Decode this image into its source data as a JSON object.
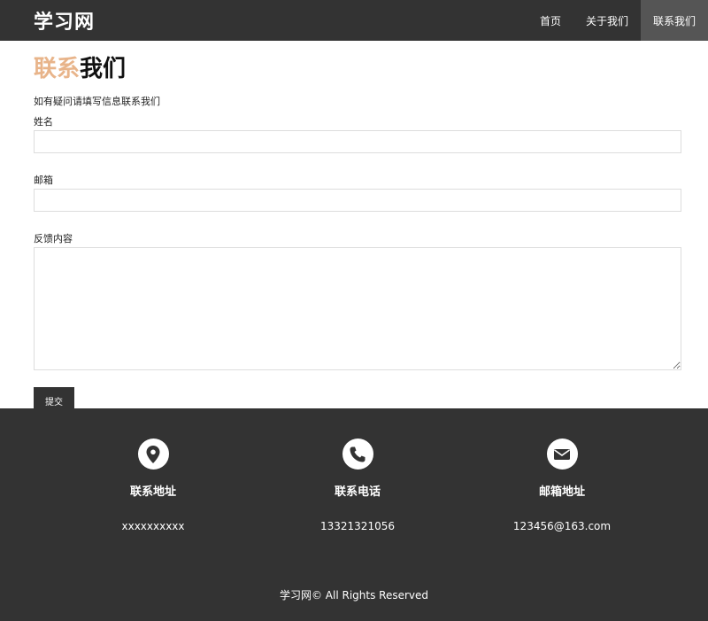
{
  "header": {
    "logo": "学习网",
    "nav": [
      {
        "label": "首页"
      },
      {
        "label": "关于我们"
      },
      {
        "label": "联系我们"
      }
    ]
  },
  "main": {
    "title_accent": "联系",
    "title_rest": "我们",
    "subtitle": "如有疑问请填写信息联系我们",
    "name_label": "姓名",
    "email_label": "邮箱",
    "feedback_label": "反馈内容",
    "submit_label": "提交"
  },
  "footer": {
    "columns": [
      {
        "icon": "location-pin-icon",
        "title": "联系地址",
        "value": "xxxxxxxxxx"
      },
      {
        "icon": "phone-icon",
        "title": "联系电话",
        "value": "13321321056"
      },
      {
        "icon": "envelope-icon",
        "title": "邮箱地址",
        "value": "123456@163.com"
      }
    ],
    "copyright": "学习网© All Rights Reserved"
  },
  "colors": {
    "header_bg": "#333333",
    "nav_active_bg": "#555555",
    "title_accent": "#e8b48a",
    "footer_bg": "#333333"
  }
}
